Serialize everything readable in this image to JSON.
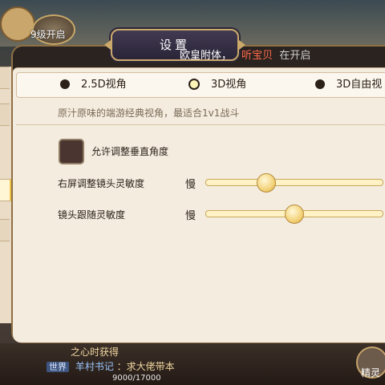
{
  "hud": {
    "level_text": "9级开启"
  },
  "dialog": {
    "title": "设置",
    "ticker": {
      "prefix": "欧皇附体，",
      "name": "听宝贝",
      "suffix": "在开启"
    },
    "view_options": [
      {
        "label": "2.5D视角",
        "selected": false
      },
      {
        "label": "3D视角",
        "selected": true
      },
      {
        "label": "3D自由视",
        "selected": false
      }
    ],
    "description": "原汁原味的端游经典视角，最适合1v1战斗",
    "vertical_angle": {
      "label": "允许调整垂直角度",
      "checked": false
    },
    "sliders": [
      {
        "label": "右屏调整镜头灵敏度",
        "slow_label": "慢",
        "value": 0.34
      },
      {
        "label": "镜头跟随灵敏度",
        "slow_label": "慢",
        "value": 0.5
      }
    ]
  },
  "chat": {
    "line1": "之心时获得",
    "channel": "世界",
    "sender": "羊村书记",
    "message": "：求大佬带本",
    "progress": "9000/17000"
  },
  "hero_button": {
    "label": "精灵"
  }
}
